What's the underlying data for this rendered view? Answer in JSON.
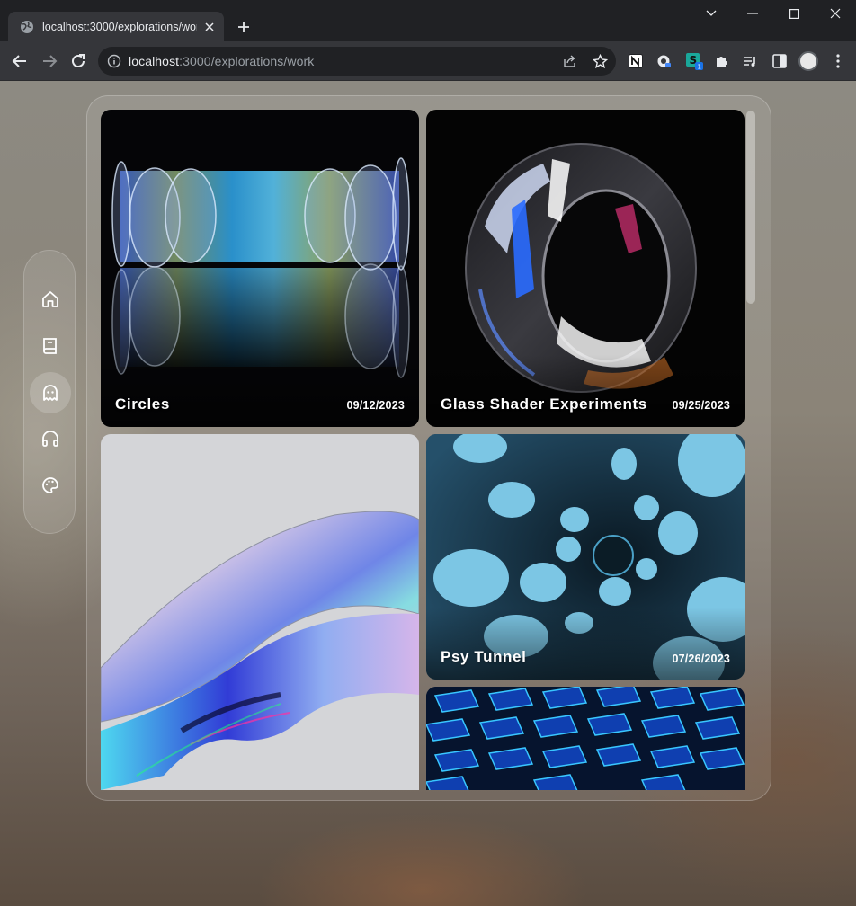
{
  "browser": {
    "tab_title": "localhost:3000/explorations/work",
    "url_host": "localhost",
    "url_rest": ":3000/explorations/work"
  },
  "sidenav": {
    "items": [
      {
        "name": "home",
        "icon": "home-icon",
        "active": false
      },
      {
        "name": "book",
        "icon": "book-icon",
        "active": false
      },
      {
        "name": "ghost",
        "icon": "ghost-icon",
        "active": true
      },
      {
        "name": "headphones",
        "icon": "headphones-icon",
        "active": false
      },
      {
        "name": "palette",
        "icon": "palette-icon",
        "active": false
      }
    ]
  },
  "gallery": {
    "cards": [
      {
        "title": "Circles",
        "date": "09/12/2023"
      },
      {
        "title": "Glass Shader Experiments",
        "date": "09/25/2023"
      },
      {
        "title": "",
        "date": ""
      },
      {
        "title": "Psy Tunnel",
        "date": "07/26/2023"
      },
      {
        "title": "",
        "date": ""
      }
    ]
  },
  "colors": {
    "chrome_bg": "#202124",
    "toolbar_bg": "#35363a",
    "accent_cyan": "#3fc7e8"
  }
}
